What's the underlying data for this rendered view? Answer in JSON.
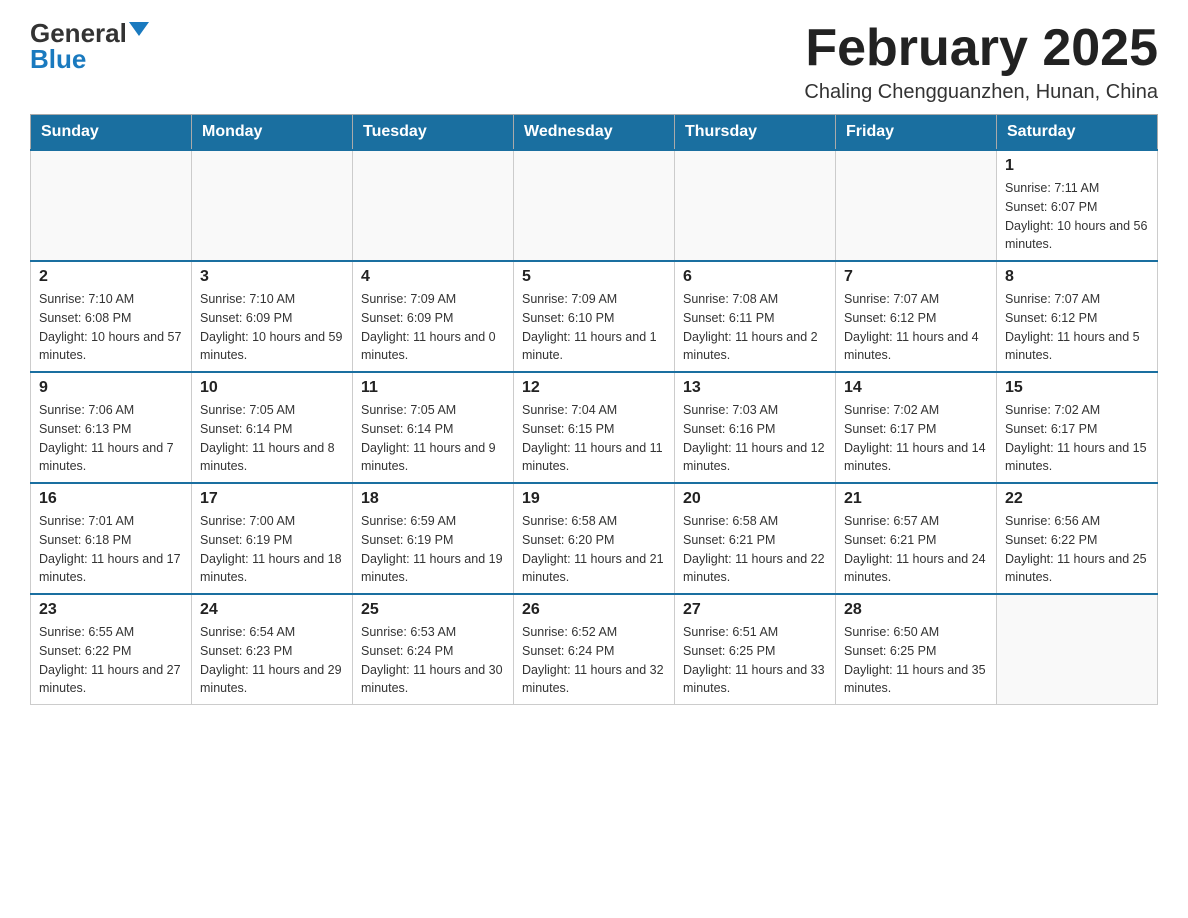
{
  "header": {
    "logo_general": "General",
    "logo_blue": "Blue",
    "month_title": "February 2025",
    "location": "Chaling Chengguanzhen, Hunan, China"
  },
  "weekdays": [
    "Sunday",
    "Monday",
    "Tuesday",
    "Wednesday",
    "Thursday",
    "Friday",
    "Saturday"
  ],
  "weeks": [
    [
      {
        "day": "",
        "sunrise": "",
        "sunset": "",
        "daylight": ""
      },
      {
        "day": "",
        "sunrise": "",
        "sunset": "",
        "daylight": ""
      },
      {
        "day": "",
        "sunrise": "",
        "sunset": "",
        "daylight": ""
      },
      {
        "day": "",
        "sunrise": "",
        "sunset": "",
        "daylight": ""
      },
      {
        "day": "",
        "sunrise": "",
        "sunset": "",
        "daylight": ""
      },
      {
        "day": "",
        "sunrise": "",
        "sunset": "",
        "daylight": ""
      },
      {
        "day": "1",
        "sunrise": "Sunrise: 7:11 AM",
        "sunset": "Sunset: 6:07 PM",
        "daylight": "Daylight: 10 hours and 56 minutes."
      }
    ],
    [
      {
        "day": "2",
        "sunrise": "Sunrise: 7:10 AM",
        "sunset": "Sunset: 6:08 PM",
        "daylight": "Daylight: 10 hours and 57 minutes."
      },
      {
        "day": "3",
        "sunrise": "Sunrise: 7:10 AM",
        "sunset": "Sunset: 6:09 PM",
        "daylight": "Daylight: 10 hours and 59 minutes."
      },
      {
        "day": "4",
        "sunrise": "Sunrise: 7:09 AM",
        "sunset": "Sunset: 6:09 PM",
        "daylight": "Daylight: 11 hours and 0 minutes."
      },
      {
        "day": "5",
        "sunrise": "Sunrise: 7:09 AM",
        "sunset": "Sunset: 6:10 PM",
        "daylight": "Daylight: 11 hours and 1 minute."
      },
      {
        "day": "6",
        "sunrise": "Sunrise: 7:08 AM",
        "sunset": "Sunset: 6:11 PM",
        "daylight": "Daylight: 11 hours and 2 minutes."
      },
      {
        "day": "7",
        "sunrise": "Sunrise: 7:07 AM",
        "sunset": "Sunset: 6:12 PM",
        "daylight": "Daylight: 11 hours and 4 minutes."
      },
      {
        "day": "8",
        "sunrise": "Sunrise: 7:07 AM",
        "sunset": "Sunset: 6:12 PM",
        "daylight": "Daylight: 11 hours and 5 minutes."
      }
    ],
    [
      {
        "day": "9",
        "sunrise": "Sunrise: 7:06 AM",
        "sunset": "Sunset: 6:13 PM",
        "daylight": "Daylight: 11 hours and 7 minutes."
      },
      {
        "day": "10",
        "sunrise": "Sunrise: 7:05 AM",
        "sunset": "Sunset: 6:14 PM",
        "daylight": "Daylight: 11 hours and 8 minutes."
      },
      {
        "day": "11",
        "sunrise": "Sunrise: 7:05 AM",
        "sunset": "Sunset: 6:14 PM",
        "daylight": "Daylight: 11 hours and 9 minutes."
      },
      {
        "day": "12",
        "sunrise": "Sunrise: 7:04 AM",
        "sunset": "Sunset: 6:15 PM",
        "daylight": "Daylight: 11 hours and 11 minutes."
      },
      {
        "day": "13",
        "sunrise": "Sunrise: 7:03 AM",
        "sunset": "Sunset: 6:16 PM",
        "daylight": "Daylight: 11 hours and 12 minutes."
      },
      {
        "day": "14",
        "sunrise": "Sunrise: 7:02 AM",
        "sunset": "Sunset: 6:17 PM",
        "daylight": "Daylight: 11 hours and 14 minutes."
      },
      {
        "day": "15",
        "sunrise": "Sunrise: 7:02 AM",
        "sunset": "Sunset: 6:17 PM",
        "daylight": "Daylight: 11 hours and 15 minutes."
      }
    ],
    [
      {
        "day": "16",
        "sunrise": "Sunrise: 7:01 AM",
        "sunset": "Sunset: 6:18 PM",
        "daylight": "Daylight: 11 hours and 17 minutes."
      },
      {
        "day": "17",
        "sunrise": "Sunrise: 7:00 AM",
        "sunset": "Sunset: 6:19 PM",
        "daylight": "Daylight: 11 hours and 18 minutes."
      },
      {
        "day": "18",
        "sunrise": "Sunrise: 6:59 AM",
        "sunset": "Sunset: 6:19 PM",
        "daylight": "Daylight: 11 hours and 19 minutes."
      },
      {
        "day": "19",
        "sunrise": "Sunrise: 6:58 AM",
        "sunset": "Sunset: 6:20 PM",
        "daylight": "Daylight: 11 hours and 21 minutes."
      },
      {
        "day": "20",
        "sunrise": "Sunrise: 6:58 AM",
        "sunset": "Sunset: 6:21 PM",
        "daylight": "Daylight: 11 hours and 22 minutes."
      },
      {
        "day": "21",
        "sunrise": "Sunrise: 6:57 AM",
        "sunset": "Sunset: 6:21 PM",
        "daylight": "Daylight: 11 hours and 24 minutes."
      },
      {
        "day": "22",
        "sunrise": "Sunrise: 6:56 AM",
        "sunset": "Sunset: 6:22 PM",
        "daylight": "Daylight: 11 hours and 25 minutes."
      }
    ],
    [
      {
        "day": "23",
        "sunrise": "Sunrise: 6:55 AM",
        "sunset": "Sunset: 6:22 PM",
        "daylight": "Daylight: 11 hours and 27 minutes."
      },
      {
        "day": "24",
        "sunrise": "Sunrise: 6:54 AM",
        "sunset": "Sunset: 6:23 PM",
        "daylight": "Daylight: 11 hours and 29 minutes."
      },
      {
        "day": "25",
        "sunrise": "Sunrise: 6:53 AM",
        "sunset": "Sunset: 6:24 PM",
        "daylight": "Daylight: 11 hours and 30 minutes."
      },
      {
        "day": "26",
        "sunrise": "Sunrise: 6:52 AM",
        "sunset": "Sunset: 6:24 PM",
        "daylight": "Daylight: 11 hours and 32 minutes."
      },
      {
        "day": "27",
        "sunrise": "Sunrise: 6:51 AM",
        "sunset": "Sunset: 6:25 PM",
        "daylight": "Daylight: 11 hours and 33 minutes."
      },
      {
        "day": "28",
        "sunrise": "Sunrise: 6:50 AM",
        "sunset": "Sunset: 6:25 PM",
        "daylight": "Daylight: 11 hours and 35 minutes."
      },
      {
        "day": "",
        "sunrise": "",
        "sunset": "",
        "daylight": ""
      }
    ]
  ]
}
